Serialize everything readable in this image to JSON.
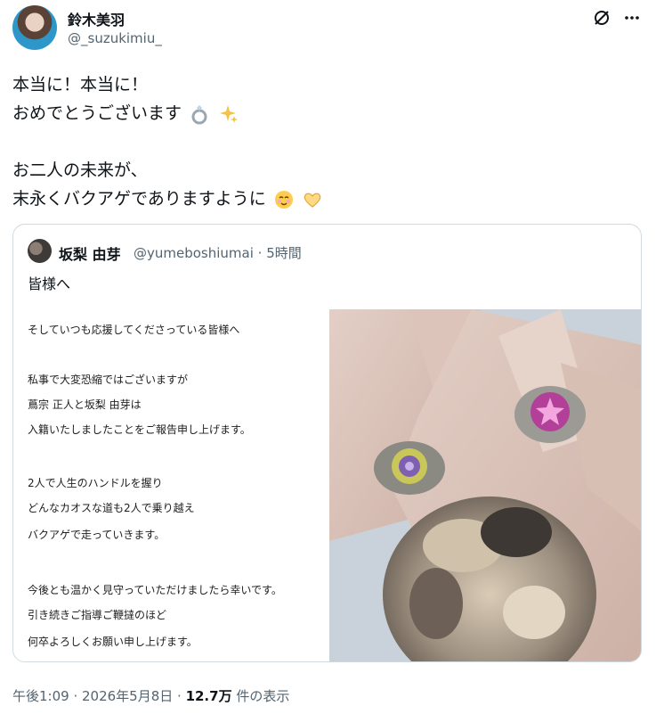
{
  "author": {
    "display_name": "鈴木美羽",
    "handle": "@_suzukimiu_"
  },
  "tweet": {
    "lines": [
      "本当に！本当に！",
      "おめでとうございます",
      "お二人の未来が、",
      "末永くバクアゲでありますように"
    ],
    "emoji": [
      "ring-emoji",
      "sparkles-emoji",
      "smiling-face-with-hearts-emoji",
      "heart-hands-emoji"
    ]
  },
  "quoted": {
    "display_name": "坂梨 由芽",
    "handle_time": "@yumeboshiumai · 5時間",
    "text": "皆様へ",
    "image_text": [
      "そしていつも応援してくださっている皆様へ",
      "",
      "私事で大変恐縮ではございますが",
      "蔦宗 正人と坂梨 由芽は",
      "入籍いたしましたことをご報告申し上げます。",
      "",
      "2人で人生のハンドルを握り",
      "どんなカオスな道も2人で乗り越え",
      "バクアゲで走っていきます。",
      "",
      "今後とも温かく見守っていただけましたら幸いです。",
      "引き続きご指導ご鞭撻のほど",
      "何卒よろしくお願い申し上げます。"
    ]
  },
  "meta": {
    "timestamp": "午後1:09 · 2026年5月8日 · ",
    "views": "12.7万",
    "views_suffix": " 件の表示"
  }
}
